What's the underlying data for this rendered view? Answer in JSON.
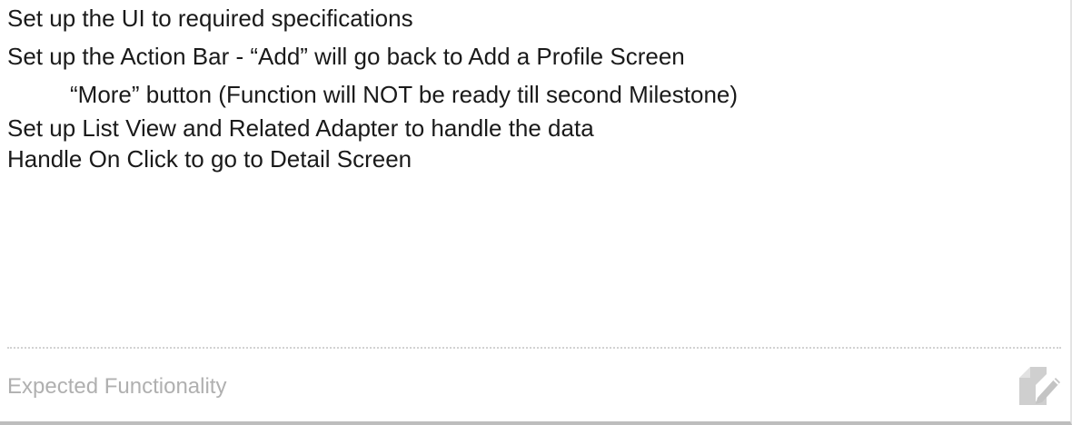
{
  "tasks": [
    "Set up the UI to required specifications",
    "Set up the Action Bar -  “Add” will go back to Add a Profile Screen",
    "“More” button (Function will NOT be ready till second Milestone)",
    "Set up List View and Related Adapter to handle the data",
    "Handle On Click to go to Detail Screen"
  ],
  "footer": {
    "label": "Expected Functionality",
    "edit_icon": "edit-note-icon"
  },
  "colors": {
    "text": "#1a1a1a",
    "footer_text": "#b0b0b0",
    "icon": "#cfcfcf",
    "divider": "#d2d2d2"
  }
}
